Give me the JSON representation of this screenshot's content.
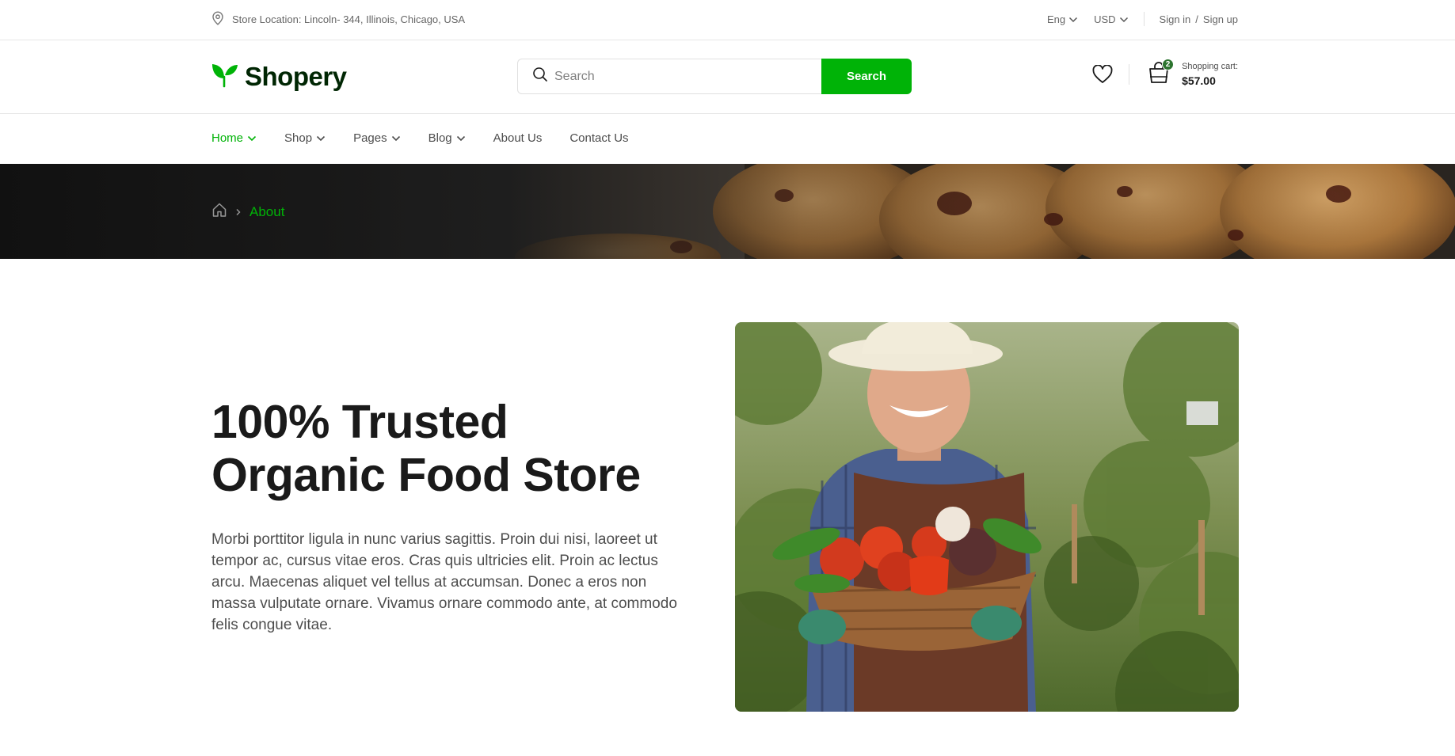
{
  "topbar": {
    "location_text": "Store Location: Lincoln- 344, Illinois, Chicago, USA",
    "language": "Eng",
    "currency": "USD",
    "sign_in": "Sign in",
    "slash": "/",
    "sign_up": "Sign up"
  },
  "header": {
    "logo_text": "Shopery",
    "search": {
      "placeholder": "Search",
      "button_label": "Search"
    },
    "cart": {
      "count": "2",
      "label": "Shopping cart:",
      "amount": "$57.00"
    }
  },
  "nav": {
    "items": [
      {
        "label": "Home",
        "dropdown": true,
        "active": true
      },
      {
        "label": "Shop",
        "dropdown": true
      },
      {
        "label": "Pages",
        "dropdown": true
      },
      {
        "label": "Blog",
        "dropdown": true
      },
      {
        "label": "About Us",
        "dropdown": false
      },
      {
        "label": "Contact Us",
        "dropdown": false
      }
    ]
  },
  "breadcrumb": {
    "current": "About"
  },
  "hero": {
    "title_line1": "100% Trusted",
    "title_line2": "Organic Food Store",
    "paragraph": "Morbi porttitor ligula in nunc varius sagittis. Proin dui nisi, laoreet ut tempor ac, cursus vitae eros. Cras quis ultricies elit. Proin ac lectus arcu. Maecenas aliquet vel tellus at accumsan. Donec a eros non massa vulputate ornare. Vivamus ornare commodo ante, at commodo felis congue vitae."
  },
  "colors": {
    "accent": "#00b307",
    "accent_dark": "#2c742f",
    "logo_text": "#002603",
    "text_muted": "#4d4d4d"
  },
  "icons": [
    "map-pin-icon",
    "chevron-down-icon",
    "leaf-logo-icon",
    "search-icon",
    "heart-icon",
    "shopping-bag-icon",
    "home-icon",
    "chevron-right-icon"
  ]
}
